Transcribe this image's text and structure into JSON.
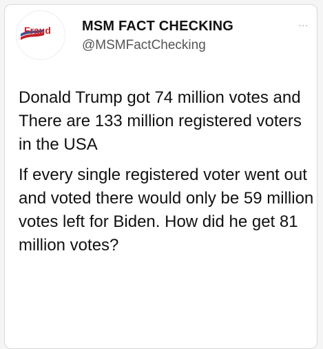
{
  "tweet": {
    "avatar_text": "Fraud",
    "display_name": "MSM FACT CHECKING",
    "handle": "@MSMFactChecking",
    "more_label": "...",
    "paragraphs": [
      "Donald Trump got 74 million votes and\nThere are 133 million registered voters in the USA",
      "If every single registered voter went out and voted there would only be 59 million votes left for Biden. How did he get 81 million votes?"
    ],
    "colors": {
      "avatar_red": "#c4202b",
      "avatar_blue": "#2e5b9a"
    }
  }
}
